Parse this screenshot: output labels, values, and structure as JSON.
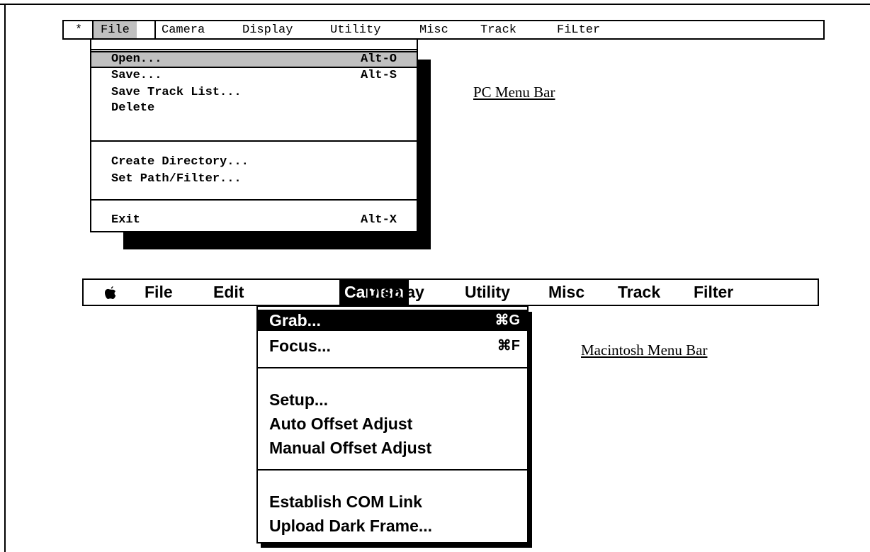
{
  "pc_menubar": {
    "system_label": "*",
    "items": [
      "File",
      "Camera",
      "Display",
      "Utility",
      "Misc",
      "Track",
      "FiLter"
    ],
    "active_item": "File"
  },
  "pc_file_menu": {
    "items": [
      {
        "label": "Open...",
        "shortcut": "Alt-O",
        "highlighted": true
      },
      {
        "label": "Save...",
        "shortcut": "Alt-S"
      },
      {
        "label": "Save Track List...",
        "shortcut": ""
      },
      {
        "label": "Delete",
        "shortcut": ""
      },
      {
        "label": "Create Directory...",
        "shortcut": ""
      },
      {
        "label": "Set Path/Filter...",
        "shortcut": ""
      },
      {
        "label": "Exit",
        "shortcut": "Alt-X"
      }
    ]
  },
  "pc_caption": "PC Menu Bar",
  "mac_menubar": {
    "apple_icon": "apple-logo",
    "items": [
      "File",
      "Edit",
      "Camera",
      "Display",
      "Utility",
      "Misc",
      "Track",
      "Filter"
    ],
    "active_item": "Camera"
  },
  "mac_camera_menu": {
    "items": [
      {
        "label": "Grab...",
        "shortcut": "⌘G",
        "highlighted": true
      },
      {
        "label": "Focus...",
        "shortcut": "⌘F"
      },
      {
        "label": "Setup...",
        "shortcut": ""
      },
      {
        "label": "Auto Offset Adjust",
        "shortcut": ""
      },
      {
        "label": "Manual Offset Adjust",
        "shortcut": ""
      },
      {
        "label": "Establish COM Link",
        "shortcut": ""
      },
      {
        "label": "Upload Dark Frame...",
        "shortcut": ""
      }
    ]
  },
  "mac_caption": "Macintosh Menu Bar",
  "colors": {
    "pc_highlight": "#c0c0c0",
    "mac_highlight": "#000000"
  }
}
